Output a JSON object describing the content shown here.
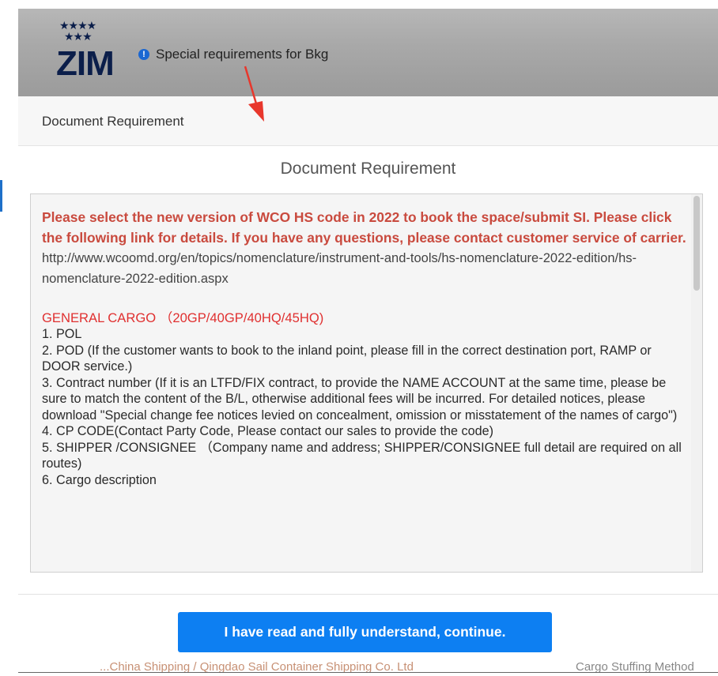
{
  "background": {
    "footer_left": "...China Shipping / Qingdao Sail Container Shipping Co. Ltd",
    "footer_right": "Cargo Stuffing Method"
  },
  "header": {
    "logo_text": "ZIM",
    "notice_icon": "info-circle-icon",
    "notice_text": "Special requirements for Bkg"
  },
  "modal": {
    "title_bar_label": "Document Requirement",
    "heading": "Document Requirement",
    "intro": "Please select the new version of WCO HS code in 2022 to book the space/submit SI. Please click the following link for details. If you have any questions, please contact customer service of carrier.",
    "link": "http://www.wcoomd.org/en/topics/nomenclature/instrument-and-tools/hs-nomenclature-2022-edition/hs-nomenclature-2022-edition.aspx",
    "section_title": "GENERAL CARGO （20GP/40GP/40HQ/45HQ)",
    "items": [
      "1. POL",
      "2. POD (If the customer wants to book to the inland point, please fill in the correct destination port, RAMP or DOOR service.)",
      "3. Contract number (If it is an LTFD/FIX contract, to provide the NAME ACCOUNT at the same time, please be sure to match the content of the B/L, otherwise additional fees will be incurred. For detailed notices, please download \"Special change fee notices levied on concealment, omission or misstatement of the names of cargo\")",
      "4. CP CODE(Contact Party Code, Please contact our sales to provide the code)",
      "5. SHIPPER /CONSIGNEE （Company name and address; SHIPPER/CONSIGNEE full detail are required on all routes)",
      "6. Cargo description"
    ],
    "continue_button": "I have read and fully understand, continue."
  },
  "colors": {
    "accent_blue": "#0d7ff2",
    "intro_red": "#c94a3e",
    "section_red": "#e03030",
    "logo_navy": "#0b1e4a"
  }
}
